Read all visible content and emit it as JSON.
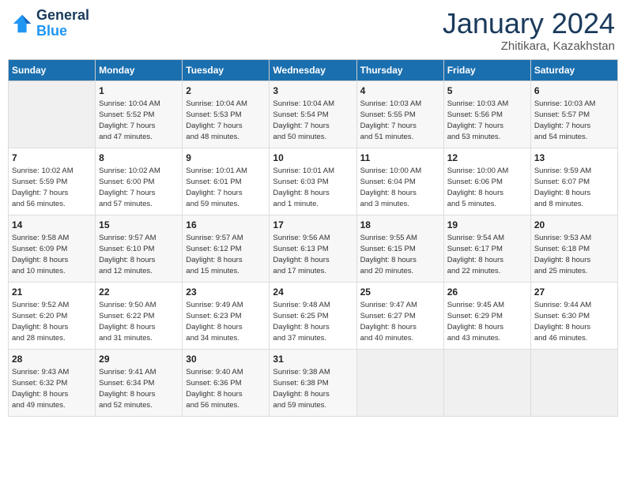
{
  "header": {
    "logo_line1": "General",
    "logo_line2": "Blue",
    "month": "January 2024",
    "location": "Zhitikara, Kazakhstan"
  },
  "weekdays": [
    "Sunday",
    "Monday",
    "Tuesday",
    "Wednesday",
    "Thursday",
    "Friday",
    "Saturday"
  ],
  "weeks": [
    [
      {
        "day": "",
        "info": ""
      },
      {
        "day": "1",
        "info": "Sunrise: 10:04 AM\nSunset: 5:52 PM\nDaylight: 7 hours\nand 47 minutes."
      },
      {
        "day": "2",
        "info": "Sunrise: 10:04 AM\nSunset: 5:53 PM\nDaylight: 7 hours\nand 48 minutes."
      },
      {
        "day": "3",
        "info": "Sunrise: 10:04 AM\nSunset: 5:54 PM\nDaylight: 7 hours\nand 50 minutes."
      },
      {
        "day": "4",
        "info": "Sunrise: 10:03 AM\nSunset: 5:55 PM\nDaylight: 7 hours\nand 51 minutes."
      },
      {
        "day": "5",
        "info": "Sunrise: 10:03 AM\nSunset: 5:56 PM\nDaylight: 7 hours\nand 53 minutes."
      },
      {
        "day": "6",
        "info": "Sunrise: 10:03 AM\nSunset: 5:57 PM\nDaylight: 7 hours\nand 54 minutes."
      }
    ],
    [
      {
        "day": "7",
        "info": "Sunrise: 10:02 AM\nSunset: 5:59 PM\nDaylight: 7 hours\nand 56 minutes."
      },
      {
        "day": "8",
        "info": "Sunrise: 10:02 AM\nSunset: 6:00 PM\nDaylight: 7 hours\nand 57 minutes."
      },
      {
        "day": "9",
        "info": "Sunrise: 10:01 AM\nSunset: 6:01 PM\nDaylight: 7 hours\nand 59 minutes."
      },
      {
        "day": "10",
        "info": "Sunrise: 10:01 AM\nSunset: 6:03 PM\nDaylight: 8 hours\nand 1 minute."
      },
      {
        "day": "11",
        "info": "Sunrise: 10:00 AM\nSunset: 6:04 PM\nDaylight: 8 hours\nand 3 minutes."
      },
      {
        "day": "12",
        "info": "Sunrise: 10:00 AM\nSunset: 6:06 PM\nDaylight: 8 hours\nand 5 minutes."
      },
      {
        "day": "13",
        "info": "Sunrise: 9:59 AM\nSunset: 6:07 PM\nDaylight: 8 hours\nand 8 minutes."
      }
    ],
    [
      {
        "day": "14",
        "info": "Sunrise: 9:58 AM\nSunset: 6:09 PM\nDaylight: 8 hours\nand 10 minutes."
      },
      {
        "day": "15",
        "info": "Sunrise: 9:57 AM\nSunset: 6:10 PM\nDaylight: 8 hours\nand 12 minutes."
      },
      {
        "day": "16",
        "info": "Sunrise: 9:57 AM\nSunset: 6:12 PM\nDaylight: 8 hours\nand 15 minutes."
      },
      {
        "day": "17",
        "info": "Sunrise: 9:56 AM\nSunset: 6:13 PM\nDaylight: 8 hours\nand 17 minutes."
      },
      {
        "day": "18",
        "info": "Sunrise: 9:55 AM\nSunset: 6:15 PM\nDaylight: 8 hours\nand 20 minutes."
      },
      {
        "day": "19",
        "info": "Sunrise: 9:54 AM\nSunset: 6:17 PM\nDaylight: 8 hours\nand 22 minutes."
      },
      {
        "day": "20",
        "info": "Sunrise: 9:53 AM\nSunset: 6:18 PM\nDaylight: 8 hours\nand 25 minutes."
      }
    ],
    [
      {
        "day": "21",
        "info": "Sunrise: 9:52 AM\nSunset: 6:20 PM\nDaylight: 8 hours\nand 28 minutes."
      },
      {
        "day": "22",
        "info": "Sunrise: 9:50 AM\nSunset: 6:22 PM\nDaylight: 8 hours\nand 31 minutes."
      },
      {
        "day": "23",
        "info": "Sunrise: 9:49 AM\nSunset: 6:23 PM\nDaylight: 8 hours\nand 34 minutes."
      },
      {
        "day": "24",
        "info": "Sunrise: 9:48 AM\nSunset: 6:25 PM\nDaylight: 8 hours\nand 37 minutes."
      },
      {
        "day": "25",
        "info": "Sunrise: 9:47 AM\nSunset: 6:27 PM\nDaylight: 8 hours\nand 40 minutes."
      },
      {
        "day": "26",
        "info": "Sunrise: 9:45 AM\nSunset: 6:29 PM\nDaylight: 8 hours\nand 43 minutes."
      },
      {
        "day": "27",
        "info": "Sunrise: 9:44 AM\nSunset: 6:30 PM\nDaylight: 8 hours\nand 46 minutes."
      }
    ],
    [
      {
        "day": "28",
        "info": "Sunrise: 9:43 AM\nSunset: 6:32 PM\nDaylight: 8 hours\nand 49 minutes."
      },
      {
        "day": "29",
        "info": "Sunrise: 9:41 AM\nSunset: 6:34 PM\nDaylight: 8 hours\nand 52 minutes."
      },
      {
        "day": "30",
        "info": "Sunrise: 9:40 AM\nSunset: 6:36 PM\nDaylight: 8 hours\nand 56 minutes."
      },
      {
        "day": "31",
        "info": "Sunrise: 9:38 AM\nSunset: 6:38 PM\nDaylight: 8 hours\nand 59 minutes."
      },
      {
        "day": "",
        "info": ""
      },
      {
        "day": "",
        "info": ""
      },
      {
        "day": "",
        "info": ""
      }
    ]
  ]
}
